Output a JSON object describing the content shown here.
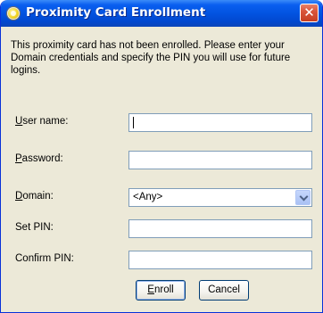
{
  "window": {
    "title": "Proximity Card Enrollment",
    "close_glyph": "✕",
    "title_icon": "proximity-card-icon"
  },
  "message": "This proximity card has not been enrolled. Please enter your Domain credentials and specify the PIN you will use for future logins.",
  "form": {
    "username": {
      "label_accel": "U",
      "label_rest": "ser name:",
      "value": ""
    },
    "password": {
      "label_accel": "P",
      "label_rest": "assword:",
      "value": ""
    },
    "domain": {
      "label_accel": "D",
      "label_rest": "omain:",
      "value": "<Any>"
    },
    "set_pin": {
      "label": "Set PIN:",
      "value": ""
    },
    "confirm_pin": {
      "label": "Confirm PIN:",
      "value": ""
    }
  },
  "buttons": {
    "enroll_accel": "E",
    "enroll_rest": "nroll",
    "cancel": "Cancel"
  },
  "colors": {
    "titlebar": "#0355e3",
    "dialog_bg": "#ece9d8",
    "close_button": "#d9553a",
    "field_border": "#7f9db9"
  }
}
